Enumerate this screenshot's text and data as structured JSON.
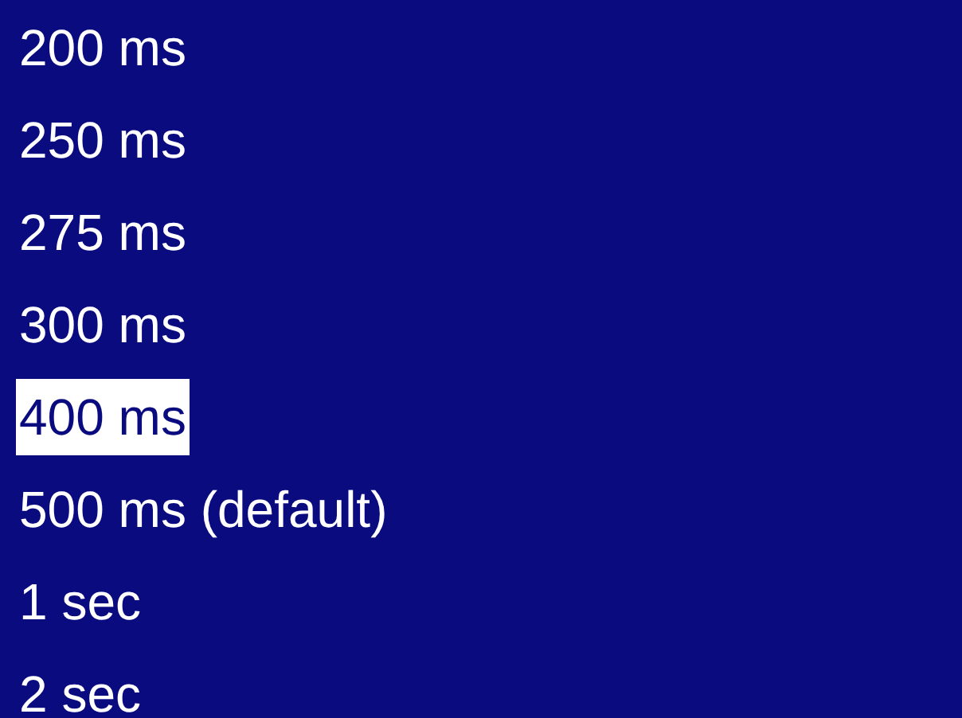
{
  "options": [
    {
      "label": "200 ms",
      "selected": false
    },
    {
      "label": "250 ms",
      "selected": false
    },
    {
      "label": "275 ms",
      "selected": false
    },
    {
      "label": "300 ms",
      "selected": false
    },
    {
      "label": "400 ms",
      "selected": true
    },
    {
      "label": "500 ms (default)",
      "selected": false
    },
    {
      "label": "1 sec",
      "selected": false
    },
    {
      "label": "2 sec",
      "selected": false
    }
  ]
}
